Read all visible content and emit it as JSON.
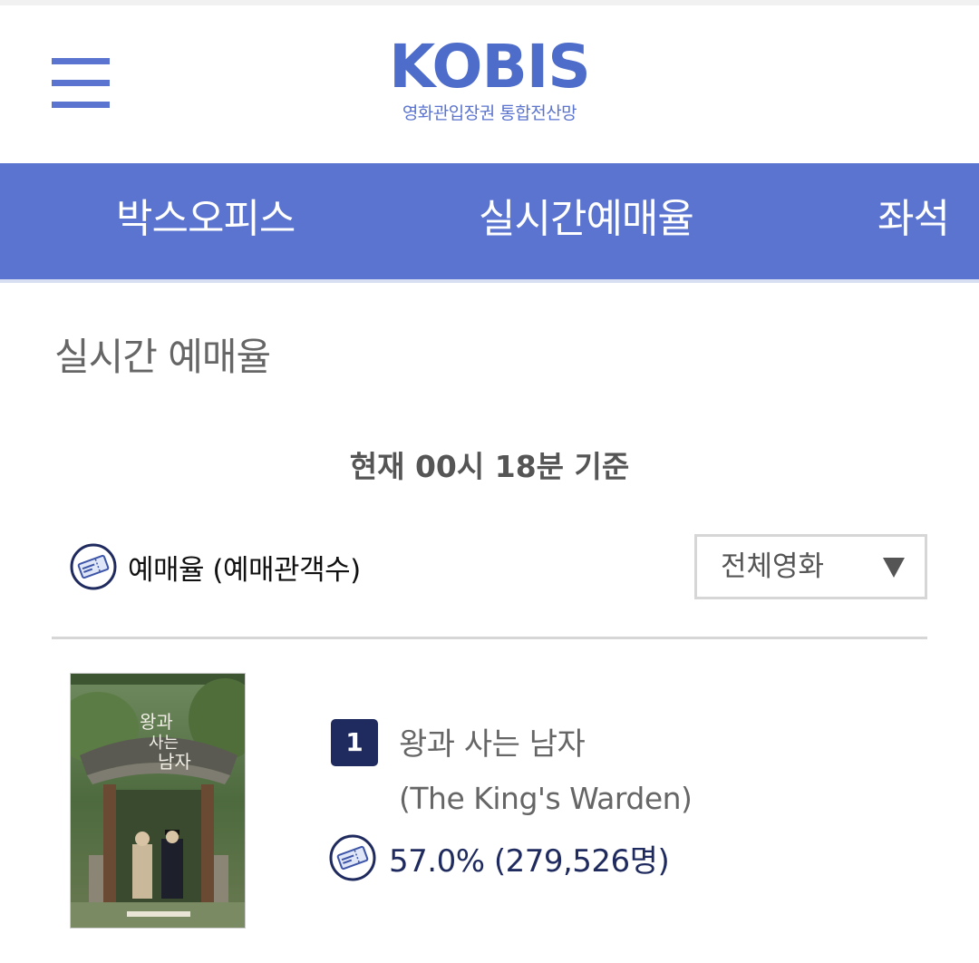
{
  "header": {
    "logo": "KOBIS",
    "logo_subtitle": "영화관입장권 통합전산망"
  },
  "nav": {
    "tabs": [
      {
        "label": "박스오피스"
      },
      {
        "label": "실시간예매율"
      },
      {
        "label": "좌석"
      }
    ]
  },
  "page": {
    "title": "실시간 예매율",
    "timestamp": "현재  00시 18분   기준"
  },
  "legend": {
    "icon": "ticket-icon",
    "text": "예매율 (예매관객수)"
  },
  "filter": {
    "selected": "전체영화"
  },
  "movies": [
    {
      "rank": "1",
      "title": "왕과 사는 남자",
      "title_en": "(The King's Warden)",
      "rate": "57.0% (279,526명)"
    }
  ],
  "colors": {
    "brand_blue": "#5b74cf",
    "logo_blue": "#4e6cc9",
    "badge_navy": "#1f2a5e"
  }
}
